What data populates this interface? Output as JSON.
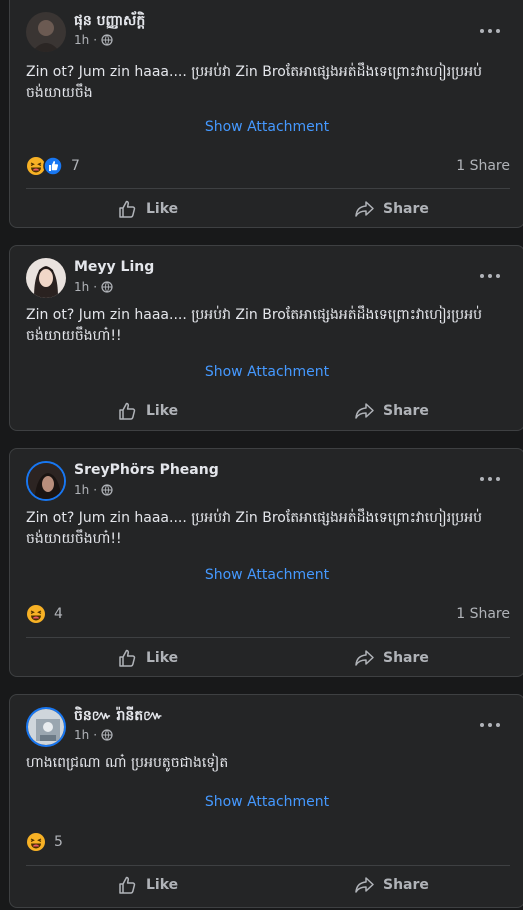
{
  "posts": [
    {
      "author": "ផុន បញ្ញាស័ក្តិ",
      "time": "1h",
      "text": "Zin ot? Jum zin haaa.... ប្រអប់វា Zin Broតែអាផ្សេងអត់ដឹងទេព្រោះវាហៀរប្រអប់ ចង់យាយចឹង",
      "attachment": "Show Attachment",
      "reaction_count": "7",
      "share_count": "1 Share",
      "like_label": "Like",
      "share_label": "Share"
    },
    {
      "author": "Meyy Ling",
      "time": "1h",
      "text": "Zin ot? Jum zin haaa.... ប្រអប់វា Zin Broតែអាផ្សេងអត់ដឹងទេព្រោះវាហៀរប្រអប់ ចង់យាយចឹងហា៎!!",
      "attachment": "Show Attachment",
      "like_label": "Like",
      "share_label": "Share"
    },
    {
      "author": "SreyPhörs Pheang",
      "time": "1h",
      "text": "Zin ot? Jum zin haaa.... ប្រអប់វា Zin Broតែអាផ្សេងអត់ដឹងទេព្រោះវាហៀរប្រអប់ ចង់យាយចឹងហា៎!!",
      "attachment": "Show Attachment",
      "reaction_count": "4",
      "share_count": "1 Share",
      "like_label": "Like",
      "share_label": "Share"
    },
    {
      "author": "ចិន៚ រ៉ានីត៚",
      "time": "1h",
      "text": "ហាងពេជ្រណា ណា៎ ប្រអបតូចជាងទៀត",
      "attachment": "Show Attachment",
      "reaction_count": "5",
      "like_label": "Like",
      "share_label": "Share"
    }
  ],
  "icons": {
    "privacy": "globe-icon",
    "menu": "more-options-icon",
    "reaction_haha": "haha-reaction-icon",
    "reaction_like": "like-reaction-icon",
    "like_action": "thumbs-up-icon",
    "share_action": "share-arrow-icon"
  },
  "colors": {
    "background": "#18191a",
    "card": "#242526",
    "link": "#4599ff",
    "secondary_text": "#b0b3b8",
    "like_blue": "#1877f2",
    "haha_yellow": "#f7b125"
  }
}
